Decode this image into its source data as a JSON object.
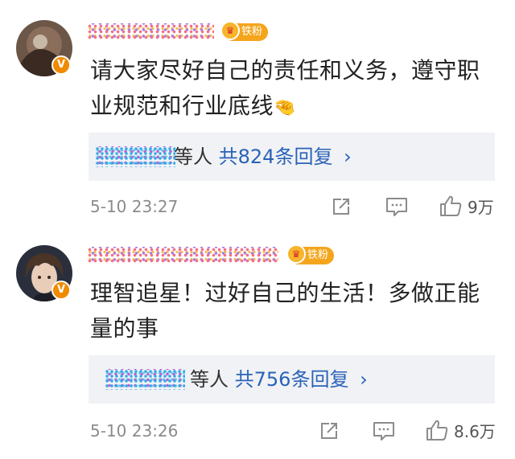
{
  "comments": [
    {
      "fan_badge": "铁粉",
      "text": "请大家尽好自己的责任和义务，遵守职业规范和行业底线",
      "emoji": "🤏",
      "reply_people": "等人",
      "reply_count": "共824条回复",
      "reply_chevron": "›",
      "timestamp": "5-10 23:27",
      "likes": "9万",
      "avatar_icon": "dark-avatar-icon",
      "verified_icon": "verified-v-icon"
    },
    {
      "fan_badge": "铁粉",
      "text": "理智追星！过好自己的生活！多做正能量的事",
      "emoji": "",
      "reply_people": "等人",
      "reply_count": "共756条回复",
      "reply_chevron": "›",
      "timestamp": "5-10 23:26",
      "likes": "8.6万",
      "avatar_icon": "anime-avatar-icon",
      "verified_icon": "verified-v-icon"
    }
  ],
  "colors": {
    "reply_link": "#2a63b8",
    "badge": "#f4a51c",
    "verified": "#f08a00",
    "meta": "#8b8b8b"
  }
}
